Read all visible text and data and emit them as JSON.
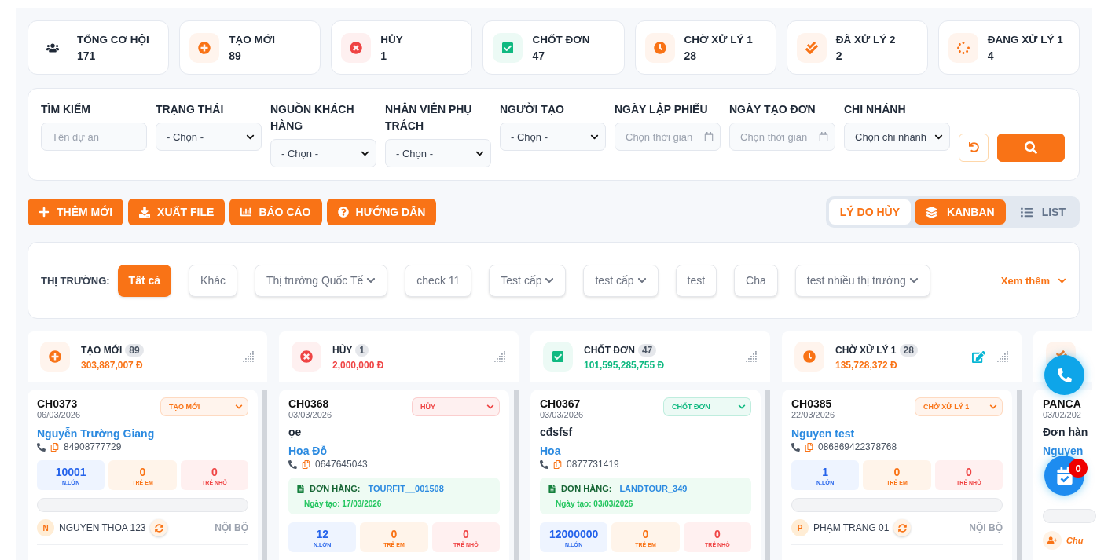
{
  "stats": [
    {
      "label": "TỔNG CƠ HỘI",
      "value": "171",
      "kind": "total"
    },
    {
      "label": "TẠO MỚI",
      "value": "89",
      "kind": "new"
    },
    {
      "label": "HỦY",
      "value": "1",
      "kind": "cancelled"
    },
    {
      "label": "CHỐT ĐƠN",
      "value": "47",
      "kind": "closed"
    },
    {
      "label": "CHỜ XỬ LÝ 1",
      "value": "28",
      "kind": "pending"
    },
    {
      "label": "ĐÃ XỬ LÝ 2",
      "value": "2",
      "kind": "processed"
    },
    {
      "label": "ĐANG XỬ LÝ 1",
      "value": "4",
      "kind": "processing"
    }
  ],
  "filters": [
    {
      "label": "TÌM KIẾM",
      "kind": "text",
      "placeholder": "Tên dự án"
    },
    {
      "label": "TRẠNG THÁI",
      "kind": "select",
      "value": "- Chọn -"
    },
    {
      "label": "NGUỒN KHÁCH HÀNG",
      "kind": "select",
      "value": "- Chọn -"
    },
    {
      "label": "NHÂN VIÊN PHỤ TRÁCH",
      "kind": "select",
      "value": "- Chọn -"
    },
    {
      "label": "NGƯỜI TẠO",
      "kind": "select",
      "value": "- Chọn -"
    },
    {
      "label": "NGÀY LẬP PHIẾU",
      "kind": "date",
      "placeholder": "Chọn thời gian"
    },
    {
      "label": "NGÀY TẠO ĐƠN",
      "kind": "date",
      "placeholder": "Chọn thời gian"
    },
    {
      "label": "CHI NHÁNH",
      "kind": "select",
      "value": "Chọn chi nhánh"
    }
  ],
  "actions": [
    {
      "label": "THÊM MỚI",
      "kind": "add"
    },
    {
      "label": "XUẤT FILE",
      "kind": "export"
    },
    {
      "label": "BÁO CÁO",
      "kind": "report"
    },
    {
      "label": "HƯỚNG DẪN",
      "kind": "guide"
    }
  ],
  "views": [
    {
      "label": "LÝ DO HỦY",
      "kind": "link",
      "selected": false
    },
    {
      "label": "KANBAN",
      "kind": "kanban",
      "selected": true
    },
    {
      "label": "LIST",
      "kind": "list",
      "selected": false
    }
  ],
  "markets": {
    "label": "THỊ TRƯỜNG:",
    "more": "Xem thêm",
    "chips": [
      {
        "label": "Tất cả",
        "selected": true,
        "dropdown": false
      },
      {
        "label": "Khác",
        "selected": false,
        "dropdown": false
      },
      {
        "label": "Thị trường Quốc Tế",
        "selected": false,
        "dropdown": true
      },
      {
        "label": "check 11",
        "selected": false,
        "dropdown": false
      },
      {
        "label": "Test cấp",
        "selected": false,
        "dropdown": true
      },
      {
        "label": "test cấp",
        "selected": false,
        "dropdown": true
      },
      {
        "label": "test",
        "selected": false,
        "dropdown": false
      },
      {
        "label": "Cha",
        "selected": false,
        "dropdown": false
      },
      {
        "label": "test nhiều thị trường",
        "selected": false,
        "dropdown": true
      }
    ]
  },
  "columns": [
    {
      "title": "TẠO MỚI",
      "count": "89",
      "amount": "303,887,007 Đ",
      "kind": "new",
      "editable": false,
      "cards": [
        {
          "code": "CH0373",
          "date": "06/03/2026",
          "status": {
            "label": "TẠO MỚI",
            "color": "#f97316"
          },
          "customer": "Nguyễn Trường Giang",
          "phone": "84908777729",
          "counts": [
            {
              "value": "10001",
              "label": "N.LỚN",
              "kind": "adult"
            },
            {
              "value": "0",
              "label": "TRẺ EM",
              "kind": "child"
            },
            {
              "value": "0",
              "label": "TRẺ NHỎ",
              "kind": "infant"
            }
          ],
          "assignee": {
            "initial": "N",
            "name": "NGUYEN THOA 123",
            "scope": "NỘI BỘ"
          }
        }
      ]
    },
    {
      "title": "HỦY",
      "count": "1",
      "amount": "2,000,000 Đ",
      "kind": "cancelled",
      "editable": false,
      "cards": [
        {
          "code": "CH0368",
          "date": "03/03/2026",
          "status": {
            "label": "HỦY",
            "color": "#ef4444"
          },
          "title": "ọe",
          "customer": "Hoa Đỗ",
          "phone": "0647645043",
          "order": {
            "label": "ĐƠN HÀNG:",
            "code": "TOURFIT__001508",
            "created": "Ngày tạo: 17/03/2026"
          },
          "counts": [
            {
              "value": "12",
              "label": "N.LỚN",
              "kind": "adult"
            },
            {
              "value": "0",
              "label": "TRẺ EM",
              "kind": "child"
            },
            {
              "value": "0",
              "label": "TRẺ NHỎ",
              "kind": "infant"
            }
          ]
        }
      ]
    },
    {
      "title": "CHỐT ĐƠN",
      "count": "47",
      "amount": "101,595,285,755 Đ",
      "kind": "closed",
      "editable": false,
      "cards": [
        {
          "code": "CH0367",
          "date": "03/03/2026",
          "status": {
            "label": "CHỐT ĐƠN",
            "color": "#10b981"
          },
          "title": "cđsfsf",
          "customer": "Hoa",
          "phone": "0877731419",
          "order": {
            "label": "ĐƠN HÀNG:",
            "code": "LANDTOUR_349",
            "created": "Ngày tạo: 03/03/2026"
          },
          "counts": [
            {
              "value": "12000000",
              "label": "N.LỚN",
              "kind": "adult"
            },
            {
              "value": "0",
              "label": "TRẺ EM",
              "kind": "child"
            },
            {
              "value": "0",
              "label": "TRẺ NHỎ",
              "kind": "infant"
            }
          ]
        }
      ]
    },
    {
      "title": "CHỜ XỬ LÝ 1",
      "count": "28",
      "amount": "135,728,372 Đ",
      "kind": "pending",
      "editable": true,
      "cards": [
        {
          "code": "CH0385",
          "date": "22/03/2026",
          "status": {
            "label": "CHỜ XỬ LÝ 1",
            "color": "#f97316"
          },
          "customer": "Nguyen test",
          "phone": "086869422378768",
          "counts": [
            {
              "value": "1",
              "label": "N.LỚN",
              "kind": "adult"
            },
            {
              "value": "0",
              "label": "TRẺ EM",
              "kind": "child"
            },
            {
              "value": "0",
              "label": "TRẺ NHỎ",
              "kind": "infant"
            }
          ],
          "assignee": {
            "initial": "P",
            "name": "PHẠM TRANG 01",
            "scope": "NỘI BỘ"
          }
        }
      ]
    },
    {
      "kind": "processed",
      "editable": false,
      "cards": [
        {
          "code": "PANCA",
          "date": "03/02/202",
          "title": "Đơn hàn",
          "customer": "Nguyen",
          "assign": "Chu"
        }
      ]
    }
  ],
  "fab": {
    "badge": "0"
  }
}
